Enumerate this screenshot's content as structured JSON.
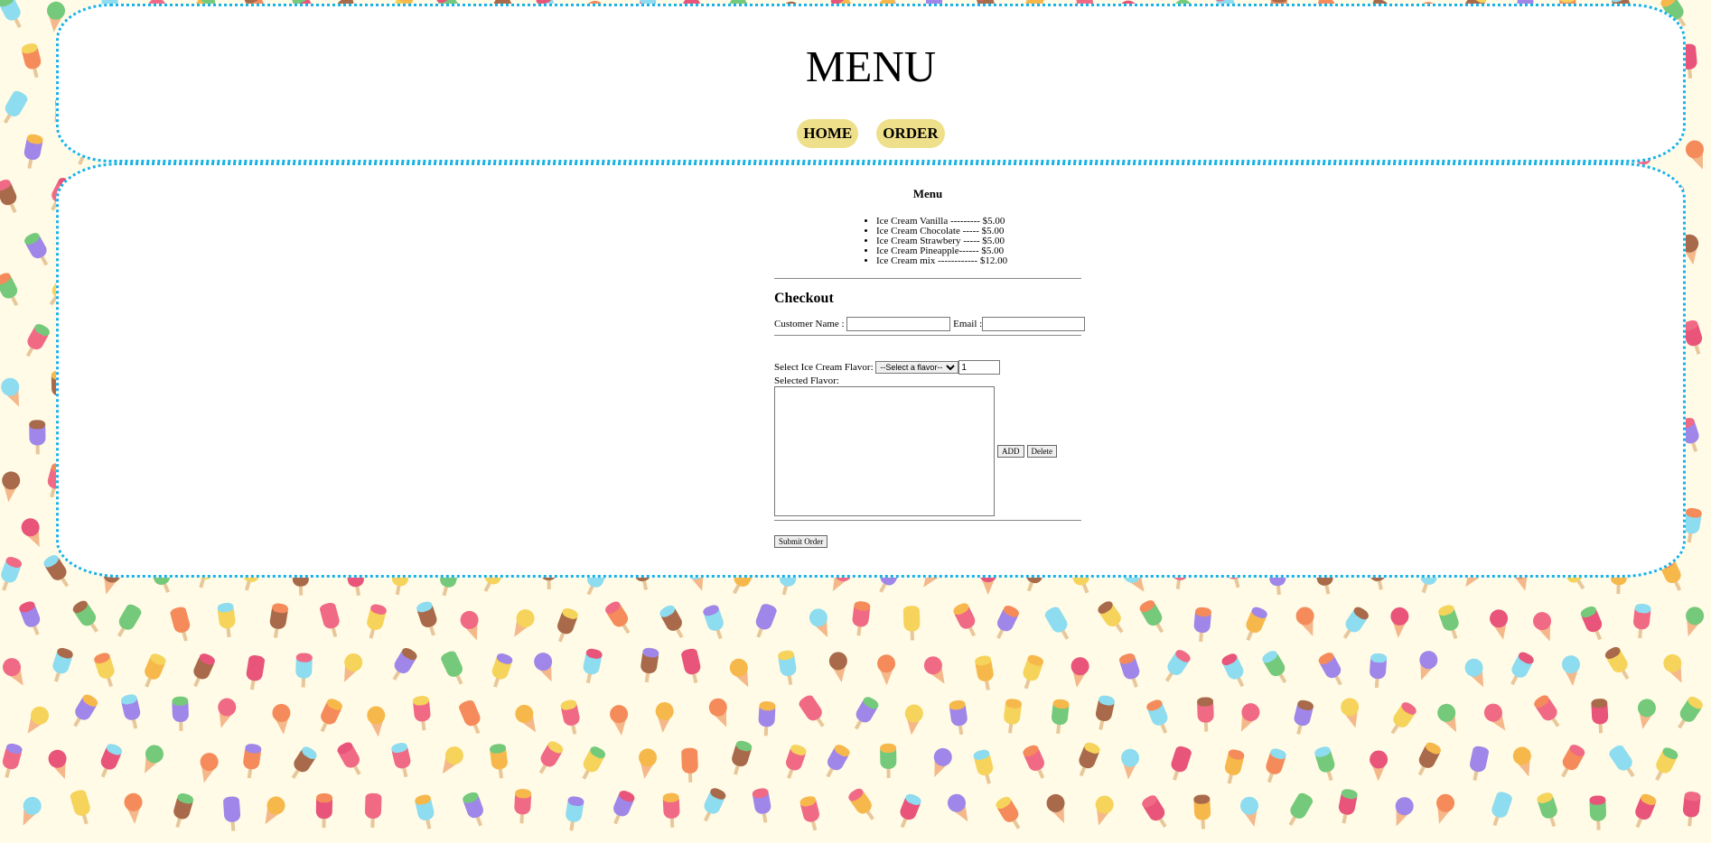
{
  "header": {
    "title": "MENU",
    "nav": [
      "HOME",
      "ORDER"
    ]
  },
  "menu": {
    "heading": "Menu",
    "items": [
      "Ice Cream Vanilla --------- $5.00",
      "Ice Cream Chocolate ----- $5.00",
      "Ice Cream Strawbery ----- $5.00",
      "Ice Cream Pineapple------ $5.00",
      "Ice Cream mix ------------ $12.00"
    ]
  },
  "checkout": {
    "heading": "Checkout",
    "customer_label": "Customer Name :",
    "customer_value": "",
    "email_label": "Email :",
    "email_value": "",
    "flavor_label": "Select Ice Cream Flavor:",
    "flavor_selected": "--Select a flavor--",
    "quantity": "1",
    "selected_label": "Selected Flavor:",
    "add_label": "ADD",
    "delete_label": "Delete",
    "submit_label": "Submit Order"
  },
  "colors": {
    "panel_border": "#1ab3e6",
    "nav_button": "#eee08a",
    "background": "#fffbe6"
  }
}
